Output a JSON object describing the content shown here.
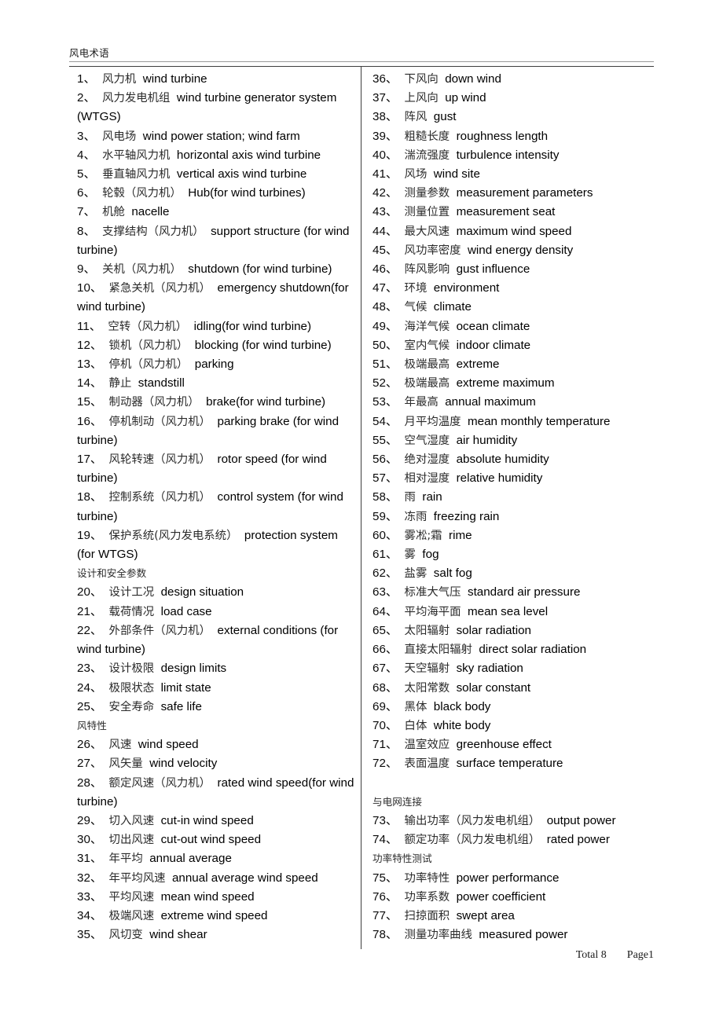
{
  "document": {
    "header_title": "风电术语",
    "footer": {
      "total_label": "Total 8",
      "page_label": "Page1"
    }
  },
  "left_column": [
    {
      "type": "entry",
      "num": "1、",
      "cn": "风力机",
      "en": "wind turbine"
    },
    {
      "type": "entry",
      "num": "2、",
      "cn": "风力发电机组",
      "en": "wind turbine generator system (WTGS)"
    },
    {
      "type": "entry",
      "num": "3、",
      "cn": "风电场",
      "en": "wind power station; wind farm"
    },
    {
      "type": "entry",
      "num": "4、",
      "cn": "水平轴风力机",
      "en": "horizontal axis wind turbine"
    },
    {
      "type": "entry",
      "num": "5、",
      "cn": "垂直轴风力机",
      "en": "vertical axis wind turbine"
    },
    {
      "type": "entry",
      "num": "6、",
      "cn": "轮毂（风力机）",
      "en": "Hub(for wind turbines)"
    },
    {
      "type": "entry",
      "num": "7、",
      "cn": "机舱",
      "en": "nacelle"
    },
    {
      "type": "entry",
      "num": "8、",
      "cn": "支撑结构（风力机）",
      "en": "support structure (for wind turbine)"
    },
    {
      "type": "entry",
      "num": "9、",
      "cn": "关机（风力机）",
      "en": "shutdown (for wind turbine)"
    },
    {
      "type": "entry",
      "num": "10、",
      "cn": "紧急关机（风力机）",
      "en": "emergency shutdown(for wind turbine)"
    },
    {
      "type": "entry",
      "num": "11、",
      "cn": "空转（风力机）",
      "en": "idling(for wind turbine)"
    },
    {
      "type": "entry",
      "num": "12、",
      "cn": "锁机（风力机）",
      "en": "blocking (for wind turbine)"
    },
    {
      "type": "entry",
      "num": "13、",
      "cn": "停机（风力机）",
      "en": "parking"
    },
    {
      "type": "entry",
      "num": "14、",
      "cn": "静止",
      "en": "standstill"
    },
    {
      "type": "entry",
      "num": "15、",
      "cn": "制动器（风力机）",
      "en": "brake(for wind turbine)"
    },
    {
      "type": "entry",
      "num": "16、",
      "cn": "停机制动（风力机）",
      "en": "parking brake (for wind turbine)"
    },
    {
      "type": "entry",
      "num": "17、",
      "cn": "风轮转速（风力机）",
      "en": "rotor speed (for wind turbine)"
    },
    {
      "type": "entry",
      "num": "18、",
      "cn": "控制系统（风力机）",
      "en": "control system (for wind turbine)"
    },
    {
      "type": "entry",
      "num": "19、",
      "cn": "保护系统(风力发电系统）",
      "en": "protection system (for WTGS)"
    },
    {
      "type": "section",
      "text": "设计和安全参数"
    },
    {
      "type": "entry",
      "num": "20、",
      "cn": "设计工况",
      "en": "design situation"
    },
    {
      "type": "entry",
      "num": "21、",
      "cn": "载荷情况",
      "en": "load case"
    },
    {
      "type": "entry",
      "num": "22、",
      "cn": "外部条件（风力机）",
      "en": "external conditions (for wind turbine)"
    },
    {
      "type": "entry",
      "num": "23、",
      "cn": "设计极限",
      "en": "design limits"
    },
    {
      "type": "entry",
      "num": "24、",
      "cn": "极限状态",
      "en": "limit state"
    },
    {
      "type": "entry",
      "num": "25、",
      "cn": "安全寿命",
      "en": "safe life"
    },
    {
      "type": "section",
      "text": "风特性"
    },
    {
      "type": "entry",
      "num": "26、",
      "cn": "风速",
      "en": "wind speed"
    },
    {
      "type": "entry",
      "num": "27、",
      "cn": "风矢量",
      "en": "wind velocity"
    },
    {
      "type": "entry",
      "num": "28、",
      "cn": "额定风速（风力机）",
      "en": "rated wind speed(for wind turbine)"
    },
    {
      "type": "entry",
      "num": "29、",
      "cn": "切入风速",
      "en": "cut-in wind speed"
    },
    {
      "type": "entry",
      "num": "30、",
      "cn": "切出风速",
      "en": "cut-out wind speed"
    },
    {
      "type": "entry",
      "num": "31、",
      "cn": "年平均",
      "en": "annual average"
    },
    {
      "type": "entry",
      "num": "32、",
      "cn": "年平均风速",
      "en": "annual average wind speed"
    },
    {
      "type": "entry",
      "num": "33、",
      "cn": "平均风速",
      "en": "mean wind speed"
    },
    {
      "type": "entry",
      "num": "34、",
      "cn": "极端风速",
      "en": "extreme wind speed"
    },
    {
      "type": "entry",
      "num": "35、",
      "cn": "风切变",
      "en": "wind shear"
    }
  ],
  "right_column": [
    {
      "type": "entry",
      "num": "36、",
      "cn": "下风向",
      "en": "down wind"
    },
    {
      "type": "entry",
      "num": "37、",
      "cn": "上风向",
      "en": "up wind"
    },
    {
      "type": "entry",
      "num": "38、",
      "cn": "阵风",
      "en": "gust"
    },
    {
      "type": "entry",
      "num": "39、",
      "cn": "粗糙长度",
      "en": "roughness length"
    },
    {
      "type": "entry",
      "num": "40、",
      "cn": "湍流强度",
      "en": "turbulence intensity"
    },
    {
      "type": "entry",
      "num": "41、",
      "cn": "风场",
      "en": "wind site"
    },
    {
      "type": "entry",
      "num": "42、",
      "cn": "测量参数",
      "en": "measurement parameters"
    },
    {
      "type": "entry",
      "num": "43、",
      "cn": "测量位置",
      "en": "measurement seat"
    },
    {
      "type": "entry",
      "num": "44、",
      "cn": "最大风速",
      "en": "maximum wind speed"
    },
    {
      "type": "entry",
      "num": "45、",
      "cn": "风功率密度",
      "en": "wind energy density"
    },
    {
      "type": "entry",
      "num": "46、",
      "cn": "阵风影响",
      "en": "gust influence"
    },
    {
      "type": "entry",
      "num": "47、",
      "cn": "环境",
      "en": "environment"
    },
    {
      "type": "entry",
      "num": "48、",
      "cn": "气候",
      "en": "climate"
    },
    {
      "type": "entry",
      "num": "49、",
      "cn": "海洋气候",
      "en": "ocean climate"
    },
    {
      "type": "entry",
      "num": "50、",
      "cn": "室内气候",
      "en": "indoor climate"
    },
    {
      "type": "entry",
      "num": "51、",
      "cn": "极端最高",
      "en": "extreme"
    },
    {
      "type": "entry",
      "num": "52、",
      "cn": "极端最高",
      "en": "extreme maximum"
    },
    {
      "type": "entry",
      "num": "53、",
      "cn": "年最高",
      "en": "annual maximum"
    },
    {
      "type": "entry",
      "num": "54、",
      "cn": "月平均温度",
      "en": "mean monthly temperature"
    },
    {
      "type": "entry",
      "num": "55、",
      "cn": "空气湿度",
      "en": "air humidity"
    },
    {
      "type": "entry",
      "num": "56、",
      "cn": "绝对湿度",
      "en": "absolute humidity"
    },
    {
      "type": "entry",
      "num": "57、",
      "cn": "相对湿度",
      "en": "relative humidity"
    },
    {
      "type": "entry",
      "num": "58、",
      "cn": "雨",
      "en": "rain"
    },
    {
      "type": "entry",
      "num": "59、",
      "cn": "冻雨",
      "en": "freezing rain"
    },
    {
      "type": "entry",
      "num": "60、",
      "cn": "雾凇;霜",
      "en": "rime"
    },
    {
      "type": "entry",
      "num": "61、",
      "cn": "雾",
      "en": "fog"
    },
    {
      "type": "entry",
      "num": "62、",
      "cn": "盐雾",
      "en": "salt fog"
    },
    {
      "type": "entry",
      "num": "63、",
      "cn": "标准大气压",
      "en": "standard air pressure"
    },
    {
      "type": "entry",
      "num": "64、",
      "cn": "平均海平面",
      "en": "mean sea level"
    },
    {
      "type": "entry",
      "num": "65、",
      "cn": "太阳辐射",
      "en": "solar radiation"
    },
    {
      "type": "entry",
      "num": "66、",
      "cn": "直接太阳辐射",
      "en": "direct solar radiation"
    },
    {
      "type": "entry",
      "num": "67、",
      "cn": "天空辐射",
      "en": "sky radiation"
    },
    {
      "type": "entry",
      "num": "68、",
      "cn": "太阳常数",
      "en": "solar constant"
    },
    {
      "type": "entry",
      "num": "69、",
      "cn": "黑体",
      "en": "black body"
    },
    {
      "type": "entry",
      "num": "70、",
      "cn": "白体",
      "en": "white body"
    },
    {
      "type": "entry",
      "num": "71、",
      "cn": "温室效应",
      "en": "greenhouse effect"
    },
    {
      "type": "entry",
      "num": "72、",
      "cn": "表面温度",
      "en": "surface temperature"
    },
    {
      "type": "blank",
      "text": ""
    },
    {
      "type": "section",
      "text": "与电网连接"
    },
    {
      "type": "entry",
      "num": "73、",
      "cn": "输出功率（风力发电机组）",
      "en": "output power"
    },
    {
      "type": "entry",
      "num": "74、",
      "cn": "额定功率（风力发电机组）",
      "en": "rated power"
    },
    {
      "type": "section",
      "text": "功率特性测试"
    },
    {
      "type": "entry",
      "num": "75、",
      "cn": "功率特性",
      "en": "power performance"
    },
    {
      "type": "entry",
      "num": "76、",
      "cn": "功率系数",
      "en": "power coefficient"
    },
    {
      "type": "entry",
      "num": "77、",
      "cn": "扫掠面积",
      "en": "swept area"
    },
    {
      "type": "entry",
      "num": "78、",
      "cn": "测量功率曲线",
      "en": "measured power"
    }
  ]
}
